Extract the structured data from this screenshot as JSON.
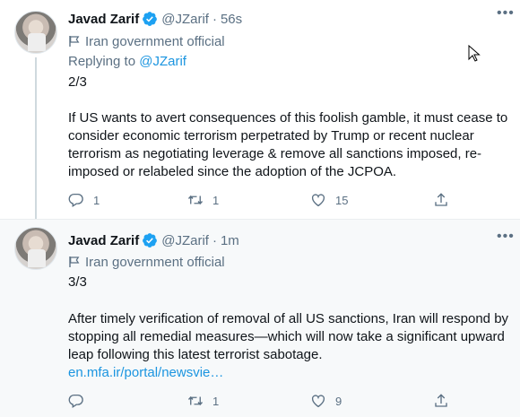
{
  "tweets": [
    {
      "author_name": "Javad Zarif",
      "handle": "@JZarif",
      "separator": "·",
      "time": "56s",
      "label": "Iran government official",
      "replying_prefix": "Replying to",
      "replying_to": "@JZarif",
      "counter": "2/3",
      "text": "If US wants to avert consequences of this foolish gamble, it must cease to consider economic terrorism perpetrated by Trump or recent nuclear terrorism as negotiating leverage & remove all sanctions imposed, re-imposed or relabeled since the adoption of the JCPOA.",
      "link": "",
      "replies": "1",
      "retweets": "1",
      "likes": "15"
    },
    {
      "author_name": "Javad Zarif",
      "handle": "@JZarif",
      "separator": "·",
      "time": "1m",
      "label": "Iran government official",
      "counter": "3/3",
      "text": "After timely verification of removal of all US sanctions, Iran will respond by stopping all remedial measures—which will now take a significant upward leap following this latest terrorist sabotage.",
      "link": "en.mfa.ir/portal/newsvie…",
      "replies": "",
      "retweets": "1",
      "likes": "9"
    }
  ],
  "colors": {
    "accent": "#1b95e0",
    "verified": "#1da1f2",
    "secondary_text": "#5b7083",
    "highlight_background": "#f7f9fa"
  },
  "icons": [
    "verified-badge-icon",
    "more-options-icon",
    "flag-icon",
    "reply-icon",
    "retweet-icon",
    "like-icon",
    "share-icon",
    "mouse-cursor-icon"
  ]
}
